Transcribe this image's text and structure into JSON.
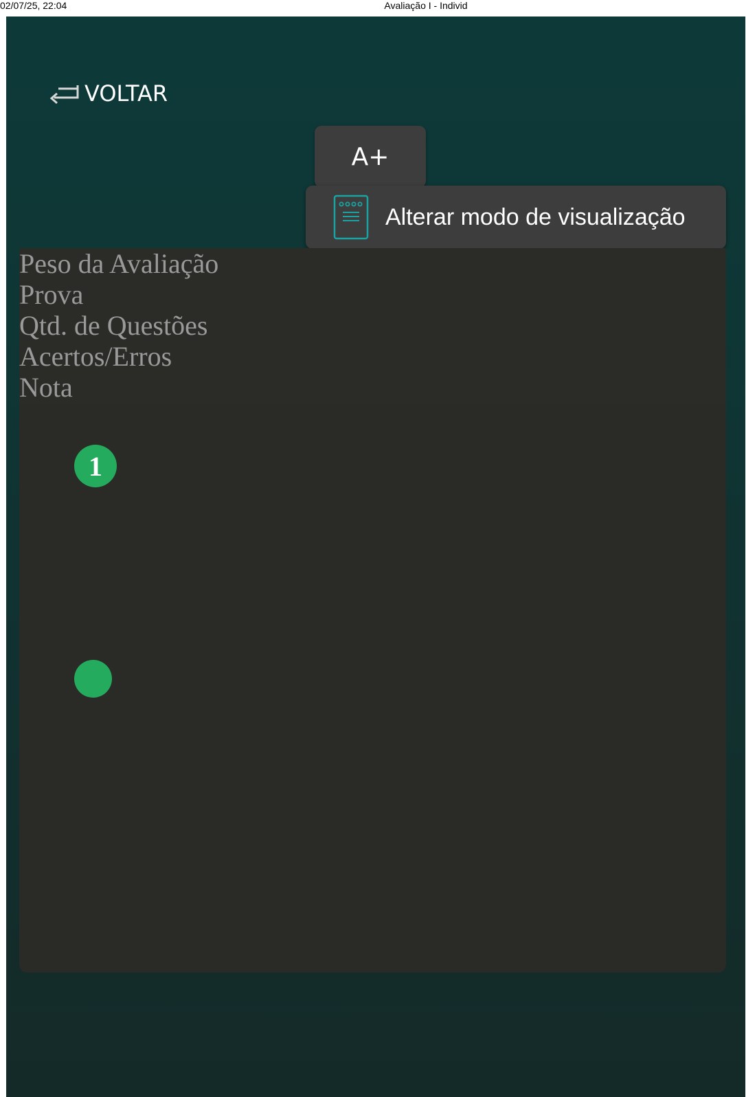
{
  "print_header": {
    "date": "02/07/25, 22:04",
    "title": "Avaliação I - Individ"
  },
  "toolbar": {
    "back_label": "VOLTAR",
    "font_size_label": "A+",
    "view_mode_label": "Alterar modo de visualização"
  },
  "icons": {
    "back": "return-arrow-icon",
    "view_mode": "document-list-icon"
  },
  "info": {
    "lines": [
      "Peso da Avaliação",
      "Prova",
      "Qtd. de Questões",
      "Acertos/Erros",
      "Nota"
    ]
  },
  "questions": {
    "first_number": "1"
  },
  "colors": {
    "background_top": "#0d3a39",
    "panel": "#2b2b28",
    "accent_green": "#25ab5e",
    "icon_teal": "#1aa3a3",
    "button": "#3d3d3d"
  }
}
